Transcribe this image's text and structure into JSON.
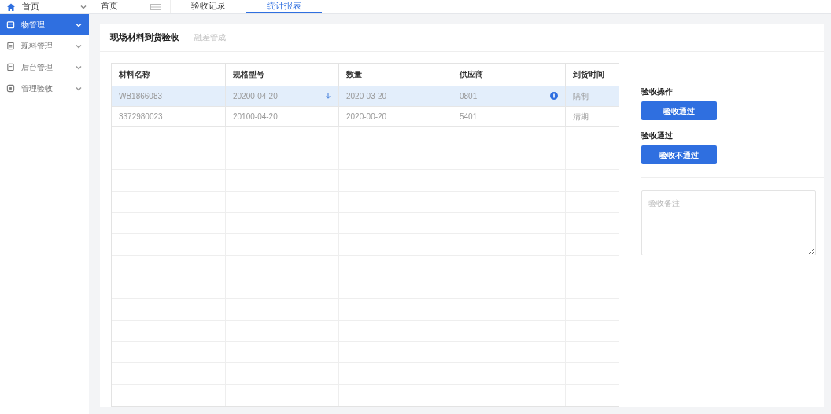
{
  "top_bar": {
    "home": {
      "label": "首页"
    },
    "tabs": [
      {
        "label": "首页",
        "selected": false
      },
      {
        "label": "验收记录",
        "selected": false
      },
      {
        "label": "统计报表",
        "selected": true
      }
    ]
  },
  "sidebar": {
    "items": [
      {
        "label": "物管理",
        "selected": true
      },
      {
        "label": "现料管理",
        "selected": false
      },
      {
        "label": "后台管理",
        "selected": false
      },
      {
        "label": "管理验收",
        "selected": false
      }
    ]
  },
  "page": {
    "title": "现场材料到货验收",
    "subtitle": "融差管成"
  },
  "table": {
    "columns": [
      "材料名称",
      "规格型号",
      "数量",
      "供应商",
      "到货时间"
    ],
    "rows": [
      {
        "cells": [
          "WB1866083",
          "20200-04-20",
          "2020-03-20",
          "0801",
          "隔制"
        ],
        "selected": true
      },
      {
        "cells": [
          "3372980023",
          "20100-04-20",
          "2020-00-20",
          "5401",
          "清期"
        ],
        "selected": false
      }
    ]
  },
  "actions": {
    "heading_1": "验收操作",
    "button_1": "验收通过",
    "heading_2": "验收通过",
    "button_2": "验收不通过",
    "remark": {
      "placeholder": "验收备注"
    }
  }
}
